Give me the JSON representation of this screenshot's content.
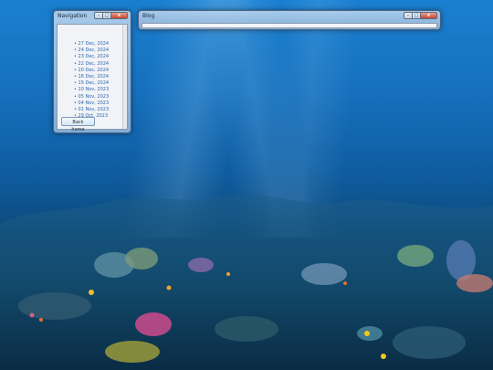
{
  "navigation_window": {
    "title": "Navigation",
    "controls": {
      "minimize": "–",
      "maximize": "□",
      "close": "x"
    },
    "dates": [
      "27 Dec, 2024",
      "24 Dec, 2024",
      "23 Dec, 2024",
      "22 Dec, 2024",
      "20 Dec, 2024",
      "16 Dec, 2024",
      "15 Dec, 2024",
      "10 Nov, 2023",
      "05 Nov, 2023",
      "04 Nov, 2023",
      "01 Nov, 2023",
      "29 Oct, 2023"
    ],
    "back_button": "Back home"
  },
  "blog_window": {
    "title": "Blog",
    "controls": {
      "minimize": "–",
      "maximize": "□",
      "close": "x"
    }
  },
  "colors": {
    "link": "#2f66b4",
    "close_button": "#c8442c"
  }
}
